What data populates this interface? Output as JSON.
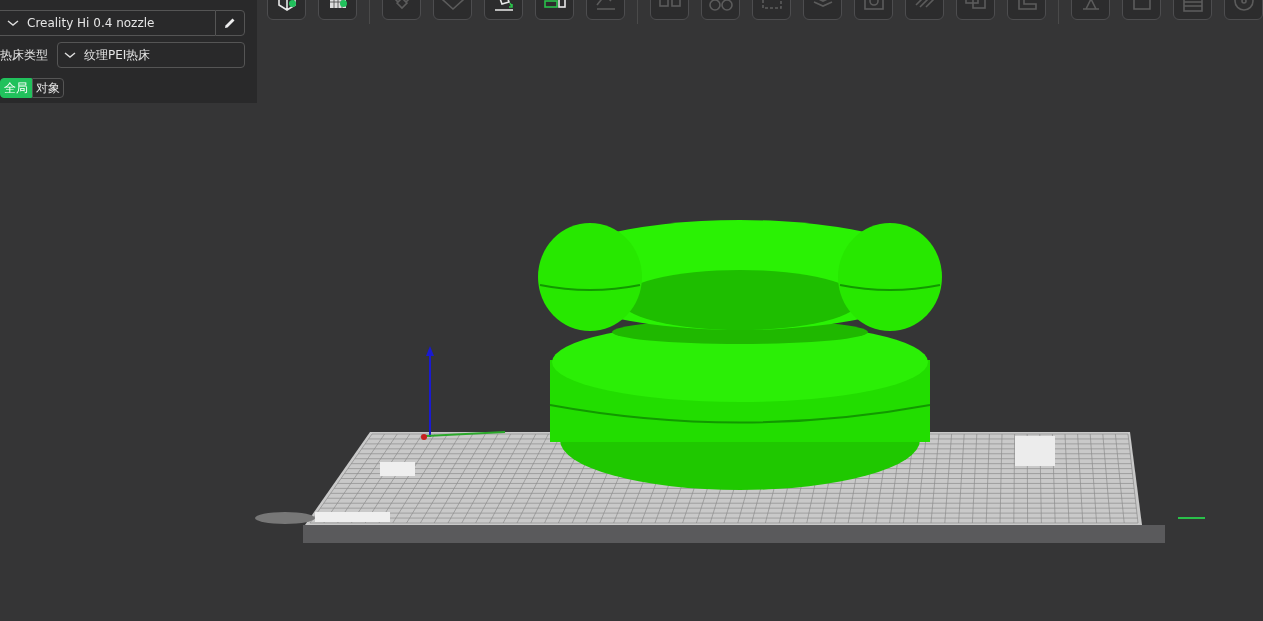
{
  "printer": {
    "value": "Creality Hi 0.4 nozzle"
  },
  "bed_type": {
    "label": "热床类型",
    "value": "纹理PEI热床"
  },
  "scope_tabs": [
    {
      "label": "全局",
      "selected": true
    },
    {
      "label": "对象",
      "selected": false
    }
  ],
  "toolbar_groups": [
    [
      {
        "kind": "cube",
        "disabled": false,
        "badge": true
      },
      {
        "kind": "grid",
        "disabled": false,
        "badge": true
      }
    ],
    [
      {
        "kind": "gems",
        "disabled": true,
        "badge": false
      },
      {
        "kind": "diamond",
        "disabled": true,
        "badge": false
      },
      {
        "kind": "arrange",
        "disabled": false,
        "badge": false
      },
      {
        "kind": "layout",
        "disabled": false,
        "badge": false
      },
      {
        "kind": "flatten",
        "disabled": true,
        "badge": false
      }
    ],
    [
      {
        "kind": "split",
        "disabled": true,
        "badge": false
      },
      {
        "kind": "gears",
        "disabled": true,
        "badge": false
      },
      {
        "kind": "bounds",
        "disabled": true,
        "badge": false
      },
      {
        "kind": "layers",
        "disabled": true,
        "badge": false
      },
      {
        "kind": "hollow",
        "disabled": true,
        "badge": false
      },
      {
        "kind": "stripes",
        "disabled": true,
        "badge": false
      },
      {
        "kind": "boolean",
        "disabled": true,
        "badge": false
      },
      {
        "kind": "ruler",
        "disabled": true,
        "badge": false
      }
    ],
    [
      {
        "kind": "support",
        "disabled": true,
        "badge": false
      },
      {
        "kind": "page",
        "disabled": true,
        "badge": false
      },
      {
        "kind": "list",
        "disabled": true,
        "badge": false
      },
      {
        "kind": "disc",
        "disabled": true,
        "badge": false
      }
    ]
  ]
}
